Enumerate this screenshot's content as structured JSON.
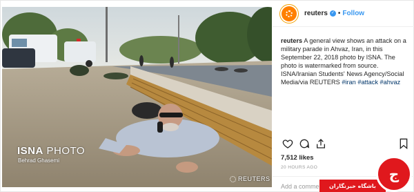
{
  "photo": {
    "watermark_brand_bold": "ISNA",
    "watermark_brand_light": " PHOTO",
    "watermark_credit": "Behrad Ghasemi",
    "watermark_agency": "REUTERS"
  },
  "header": {
    "username": "reuters",
    "verified_mark": "✓",
    "separator": "•",
    "follow_label": "Follow"
  },
  "caption": {
    "username": "reuters",
    "text": "A general view shows an attack on a military parade in Ahvaz, Iran, in this September 22, 2018 photo by ISNA. The photo is watermarked from source. ISNA/Iranian Students' News Agency/Social Media/via REUTERS",
    "hashtag_1": "#iran",
    "hashtag_2": "#attack",
    "hashtag_3": "#ahvaz"
  },
  "actions": {
    "like_icon": "heart-icon",
    "comment_icon": "comment-icon",
    "share_icon": "share-icon",
    "save_icon": "bookmark-icon"
  },
  "stats": {
    "likes": "7,512 likes",
    "time_ago": "20 HOURS AGO"
  },
  "comment_box": {
    "placeholder": "Add a comment..."
  },
  "overlay": {
    "site_name": "باشگاه خبرنگاران",
    "logo_glyph": "ج"
  },
  "colors": {
    "accent": "#3897f0",
    "badge_red": "#e0181d",
    "hashtag": "#003569"
  }
}
